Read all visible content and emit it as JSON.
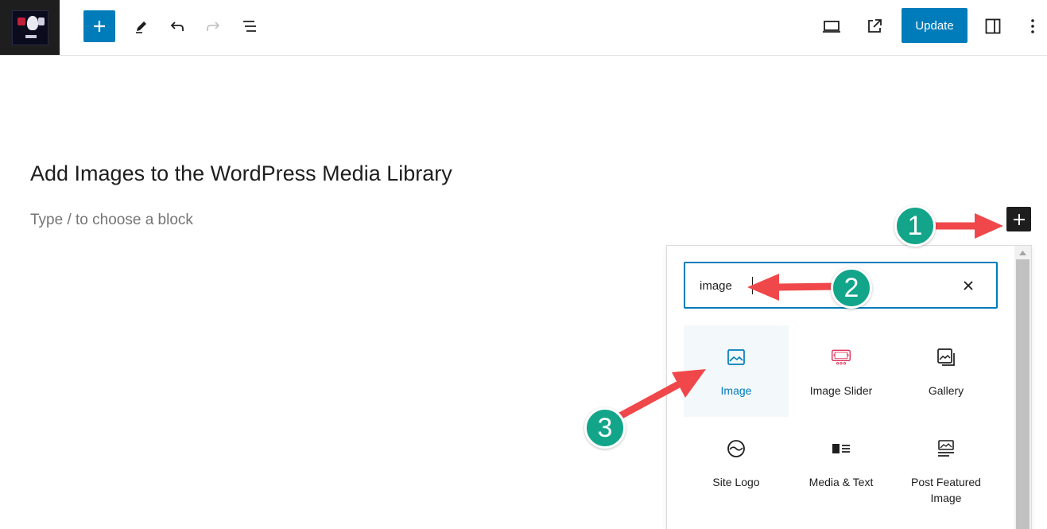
{
  "toolbar": {
    "site_logo_alt": "site logo",
    "icons": [
      "plus-icon",
      "pencil-icon",
      "undo-icon",
      "redo-icon",
      "list-view-icon",
      "desktop-preview-icon",
      "external-link-icon",
      "sidebar-icon",
      "more-vertical-icon"
    ],
    "update_label": "Update"
  },
  "editor": {
    "post_title": "Add Images to the WordPress Media Library",
    "block_placeholder": "Type / to choose a block"
  },
  "inserter": {
    "search_value": "image",
    "blocks": [
      {
        "label": "Image",
        "icon": "image-icon",
        "selected": true
      },
      {
        "label": "Image Slider",
        "icon": "image-slider-icon",
        "selected": false
      },
      {
        "label": "Gallery",
        "icon": "gallery-icon",
        "selected": false
      },
      {
        "label": "Site Logo",
        "icon": "site-logo-icon",
        "selected": false
      },
      {
        "label": "Media & Text",
        "icon": "media-text-icon",
        "selected": false
      },
      {
        "label": "Post Featured Image",
        "icon": "post-featured-image-icon",
        "selected": false
      }
    ]
  },
  "annotations": {
    "step1": "1",
    "step2": "2",
    "step3": "3"
  },
  "colors": {
    "accent": "#007cba",
    "annotation_badge": "#12a58a",
    "annotation_arrow": "#f0484a",
    "slider_icon": "#e0305a"
  }
}
